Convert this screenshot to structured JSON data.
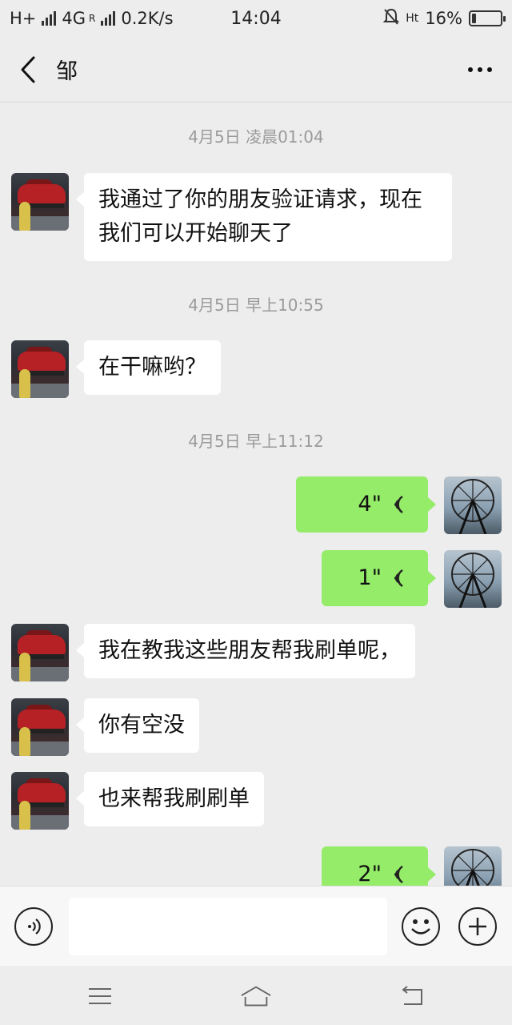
{
  "status_bar": {
    "network_left": "H+",
    "network_type": "4G",
    "network_roaming": "R",
    "speed": "0.2K/s",
    "time": "14:04",
    "network_right": "Ht",
    "battery": "16%",
    "battery_level": 0.16
  },
  "header": {
    "title": "邹"
  },
  "messages": {
    "ts1": "4月5日 凌晨01:04",
    "msg1": "我通过了你的朋友验证请求，现在我们可以开始聊天了",
    "ts2": "4月5日 早上10:55",
    "msg2": "在干嘛哟？",
    "ts3": "4月5日 早上11:12",
    "voice1": "4\"",
    "voice2": "1\"",
    "msg3": "我在教我这些朋友帮我刷单呢，",
    "msg4": "你有空没",
    "msg5": "也来帮我刷刷单",
    "voice3": "2\""
  },
  "input": {
    "placeholder": ""
  },
  "icons": {
    "back": "chevron-left-icon",
    "more": "more-dots-icon",
    "voice": "voice-input-icon",
    "emoji": "emoji-icon",
    "plus": "plus-icon"
  },
  "colors": {
    "incoming_bubble": "#ffffff",
    "outgoing_bubble": "#95ec69",
    "background": "#ededed"
  }
}
